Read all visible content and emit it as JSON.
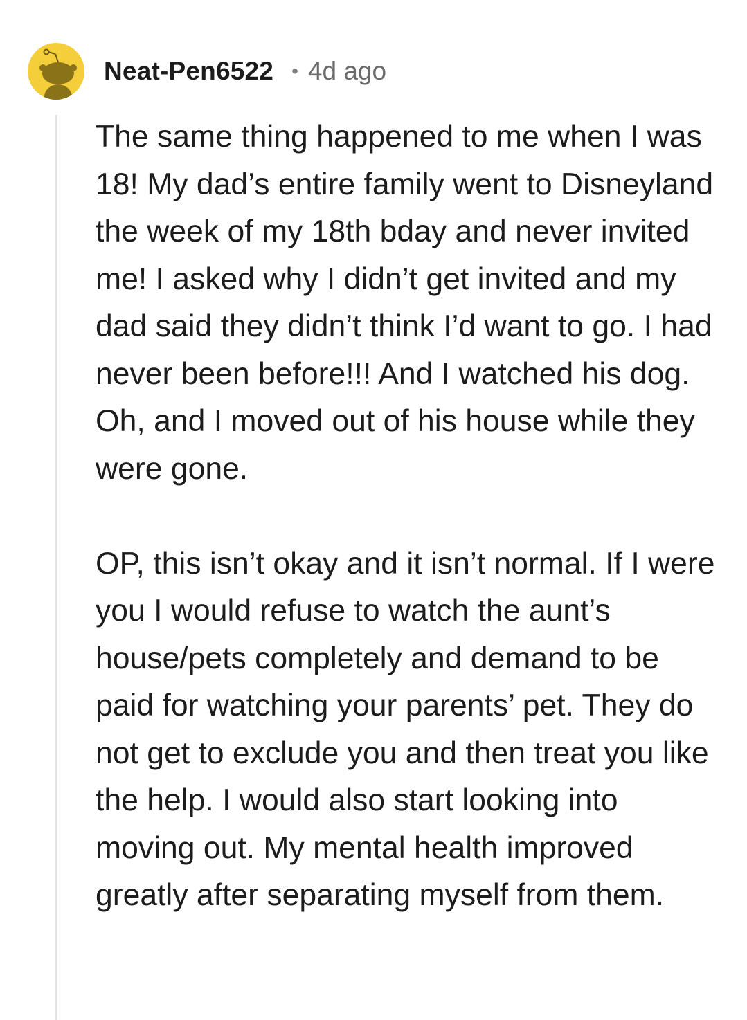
{
  "comment": {
    "author": "Neat-Pen6522",
    "separator": "•",
    "time_ago": "4d ago",
    "avatar_icon": "snoo-avatar-icon",
    "avatar_color": "#f5cf3b",
    "paragraphs": [
      "The same thing happened to me when I was 18! My dad’s entire family went to Disneyland the week of my 18th bday and never invited me! I asked why I didn’t get invited and my dad said they didn’t think I’d want to go. I had never been before!!! And I watched his dog. Oh, and I moved out of his house while they were gone.",
      "OP, this isn’t okay and it isn’t normal. If I were you I would refuse to watch the aunt’s house/pets completely and demand to be paid for watching your parents’ pet. They do not get to exclude you and then treat you like the help. I would also start looking into moving out. My mental health improved greatly after separating myself from them."
    ]
  }
}
